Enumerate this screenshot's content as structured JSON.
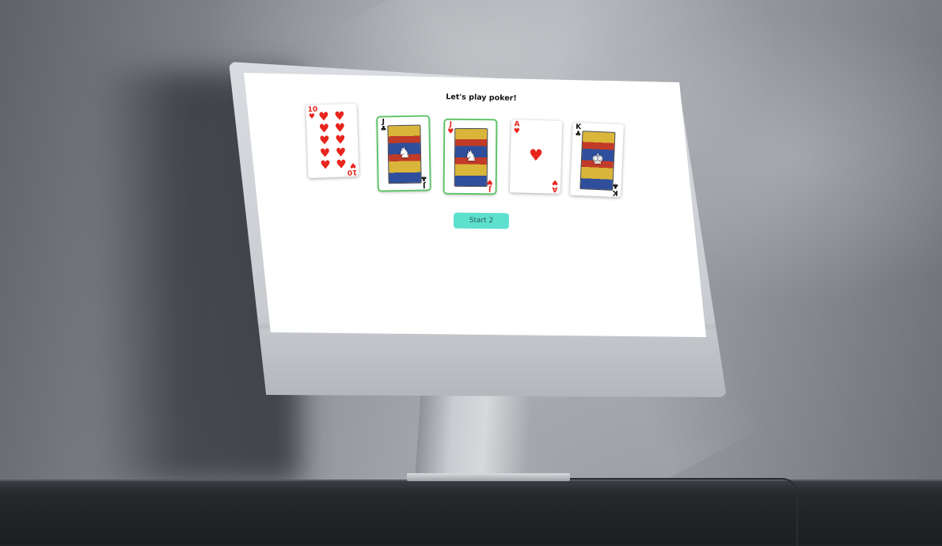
{
  "page": {
    "title": "Let's play poker!"
  },
  "cards": [
    {
      "rank": "10",
      "suit": "♥",
      "color": "red",
      "kind": "number",
      "pips": [
        "♥",
        "♥",
        "♥",
        "♥",
        "♥",
        "♥",
        "♥",
        "♥",
        "♥",
        "♥"
      ],
      "selected": false
    },
    {
      "rank": "J",
      "suit": "♣",
      "color": "black",
      "kind": "face",
      "face_glyph": "♞",
      "selected": true
    },
    {
      "rank": "J",
      "suit": "♥",
      "color": "red",
      "kind": "face",
      "face_glyph": "♞",
      "selected": true
    },
    {
      "rank": "A",
      "suit": "♥",
      "color": "red",
      "kind": "ace",
      "center": "♥",
      "selected": false
    },
    {
      "rank": "K",
      "suit": "♣",
      "color": "black",
      "kind": "face",
      "face_glyph": "♚",
      "selected": false
    }
  ],
  "start_button": {
    "label": "Start 2",
    "color": "#5ee0cf"
  },
  "colors": {
    "selected_outline": "#62c56b",
    "red_suit": "#e8241c",
    "screen_bg": "#ffffff"
  }
}
